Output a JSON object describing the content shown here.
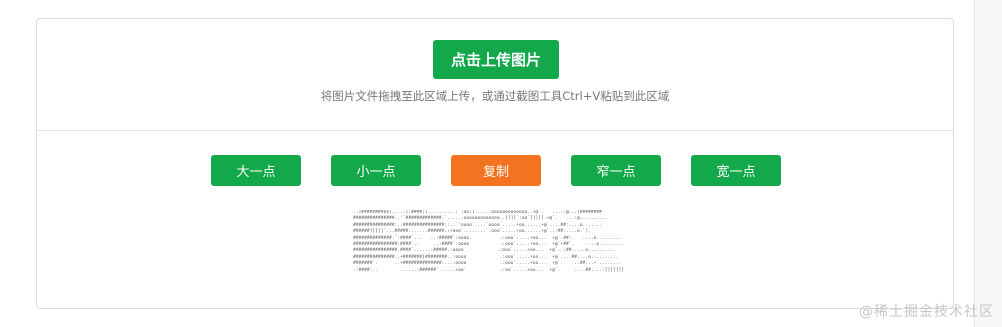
{
  "upload": {
    "button_label": "点击上传图片",
    "hint": "将图片文件拖拽至此区域上传，或通过截图工具Ctrl+V粘贴到此区域"
  },
  "buttons": [
    {
      "label": "大一点",
      "active": false
    },
    {
      "label": "小一点",
      "active": false
    },
    {
      "label": "复制",
      "active": true
    },
    {
      "label": "窄一点",
      "active": false
    },
    {
      "label": "宽一点",
      "active": false
    }
  ],
  "colors": {
    "primary_green": "#13a84a",
    "active_orange": "#f47321"
  },
  "ascii_art": "..]########$$]....:]:####;]..........;`:oo:]......ooooooooooooo..+@`.   ....:@...]########\n###############..'`#############.`......ooooooooooooo..]]]]`:oo`]]]]].+@`.   ...:@..........\n###############:..###############::..`'oooo`....`oooo`.....+oo......+@`....##:....o.......\n######]]]]]`...#####.......######.:+ooo`........`.ooo`.....+oo......+@`..:##:....o.`].\n##############.`:####`...   ..:#####`:oooo.          .:ooo`.....+oo...  +@`.##:.   ....o.........\n################:####`..     ..:####`:oooo           .:ooo`.....+oo...  +@`+##`.    ....o.........\n################.####`......:#####.:oooo            .:ooo`.....+oo...  +@`..:##.....o..........\n###############..+#######]########..:oooo            .:ooo`.....+oo...  +@`....##....o..........\n#######`.      ..+##############:...:oooo            .:ooo`.....+oo...  +@`.    ..##...+ ........\n.:####:..        ......:######`......+oo`            .:oo`.....+oo...  +@`.     ....##....:]]]]]]]",
  "watermark": "@稀土掘金技术社区"
}
